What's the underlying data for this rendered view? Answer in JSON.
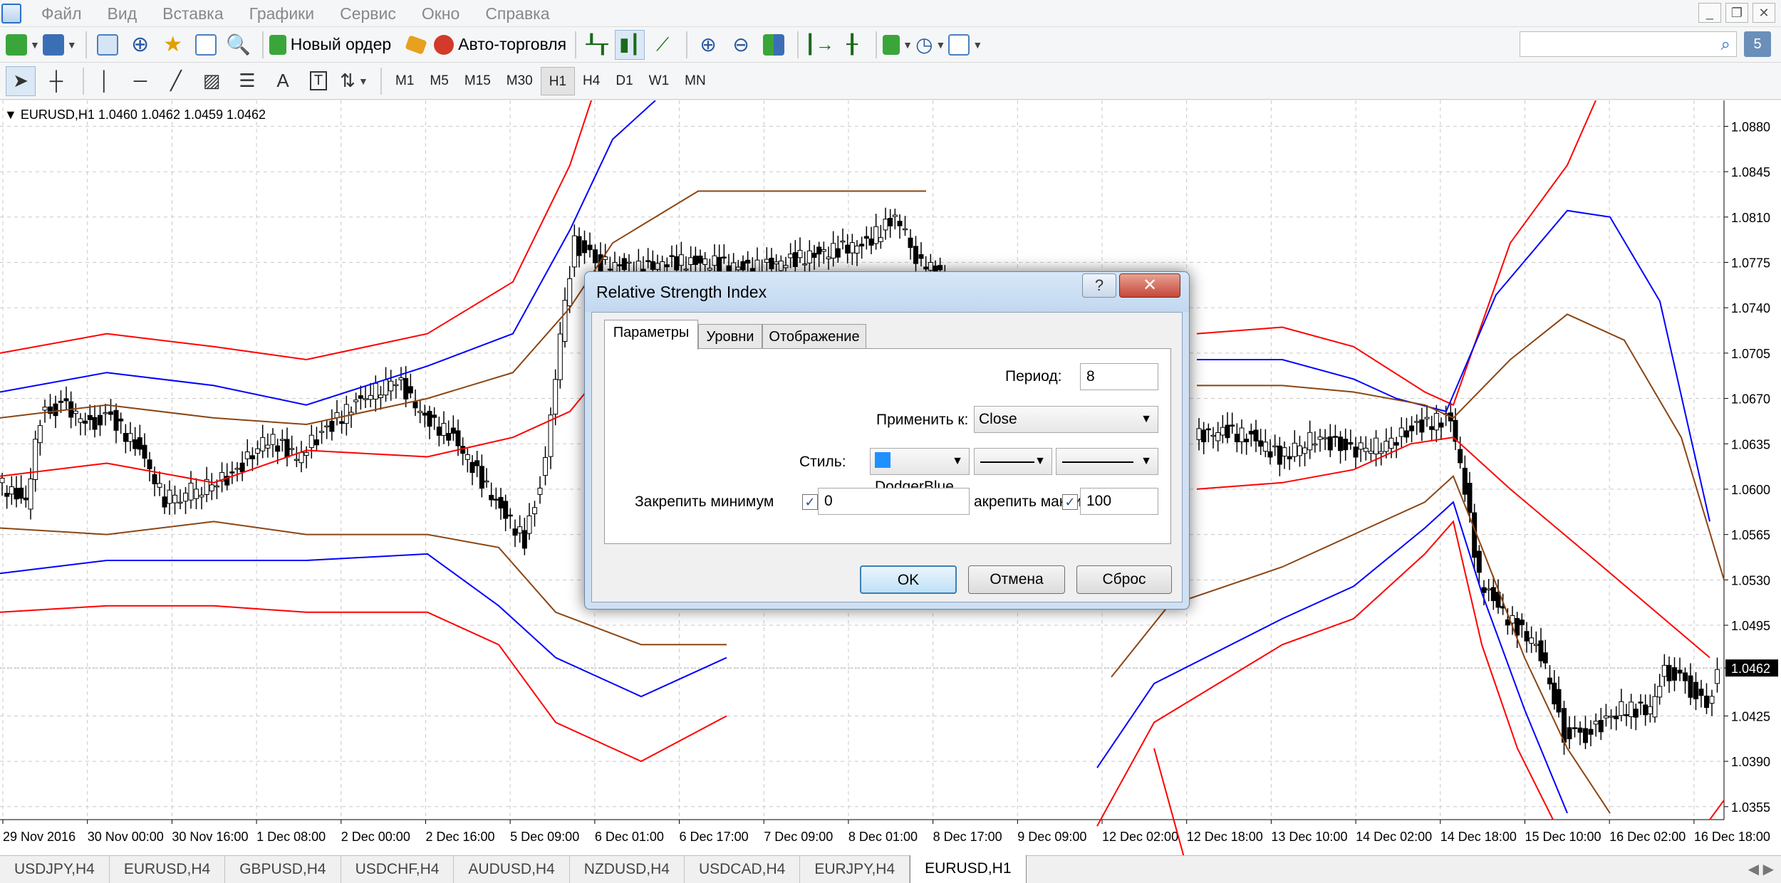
{
  "menu": [
    "Файл",
    "Вид",
    "Вставка",
    "Графики",
    "Сервис",
    "Окно",
    "Справка"
  ],
  "toolbar": {
    "new_order": "Новый ордер",
    "auto_trading": "Авто-торговля"
  },
  "drawing_tools": {
    "text_tool": "A",
    "label_tool": "T"
  },
  "timeframes": [
    "M1",
    "M5",
    "M15",
    "M30",
    "H1",
    "H4",
    "D1",
    "W1",
    "MN"
  ],
  "search": {
    "msg_count": "5"
  },
  "chart_data": {
    "type": "candlestick",
    "title": "EURUSD,H1  1.0460 1.0462 1.0459 1.0462",
    "y_ticks": [
      "1.0880",
      "1.0845",
      "1.0810",
      "1.0775",
      "1.0740",
      "1.0705",
      "1.0670",
      "1.0635",
      "1.0600",
      "1.0565",
      "1.0530",
      "1.0495",
      "1.0462",
      "1.0425",
      "1.0390",
      "1.0355"
    ],
    "current_price": "1.0462",
    "x_ticks": [
      "29 Nov 2016",
      "30 Nov 00:00",
      "30 Nov 16:00",
      "1 Dec 08:00",
      "2 Dec 00:00",
      "2 Dec 16:00",
      "5 Dec 09:00",
      "6 Dec 01:00",
      "6 Dec 17:00",
      "7 Dec 09:00",
      "8 Dec 01:00",
      "8 Dec 17:00",
      "9 Dec 09:00",
      "12 Dec 02:00",
      "12 Dec 18:00",
      "13 Dec 10:00",
      "14 Dec 02:00",
      "14 Dec 18:00",
      "15 Dec 10:00",
      "16 Dec 02:00",
      "16 Dec 18:00"
    ],
    "ylim": [
      1.0345,
      1.09
    ],
    "grid": true,
    "series_colors": {
      "price": "#000000",
      "band_outer": "#ff0000",
      "band_mid": "#0000ff",
      "band_inner": "#8b4513"
    }
  },
  "dialog": {
    "title": "Relative Strength Index",
    "help": "?",
    "close": "✕",
    "tabs": [
      "Параметры",
      "Уровни",
      "Отображение"
    ],
    "period_label": "Период:",
    "period_value": "8",
    "apply_label": "Применить к:",
    "apply_value": "Close",
    "style_label": "Стиль:",
    "color_value": "DodgerBlue",
    "color_hex": "#1e90ff",
    "fix_min_label": "Закрепить минимум",
    "fix_min_value": "0",
    "fix_max_label": "акрепить максимум",
    "fix_max_value": "100",
    "ok": "OK",
    "cancel": "Отмена",
    "reset": "Сброс"
  },
  "tabs": [
    "USDJPY,H4",
    "EURUSD,H4",
    "GBPUSD,H4",
    "USDCHF,H4",
    "AUDUSD,H4",
    "NZDUSD,H4",
    "USDCAD,H4",
    "EURJPY,H4",
    "EURUSD,H1"
  ],
  "active_tab": "EURUSD,H1"
}
